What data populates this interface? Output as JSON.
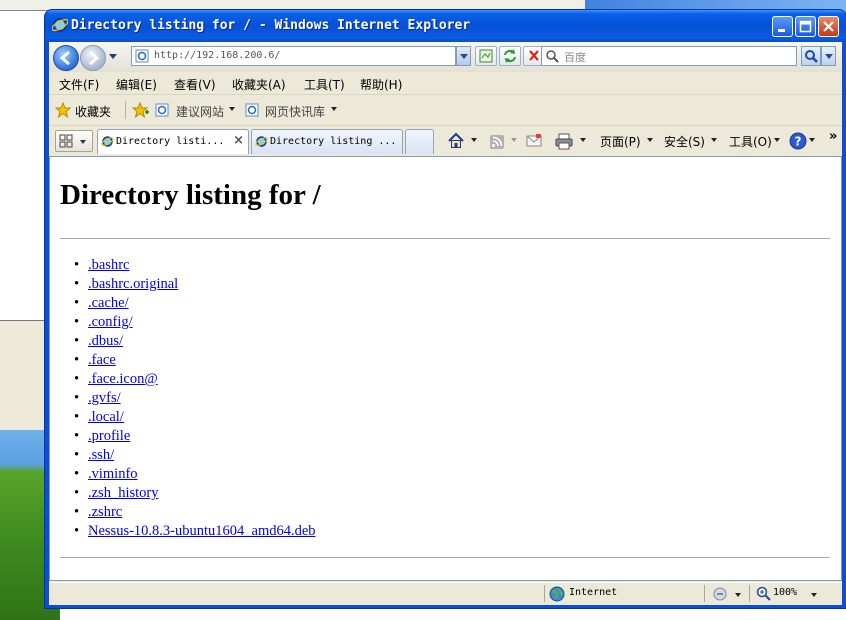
{
  "window": {
    "title": "Directory listing for / - Windows Internet Explorer"
  },
  "address": {
    "url": "http://192.168.200.6/"
  },
  "search": {
    "placeholder": "百度"
  },
  "menu": [
    "文件(F)",
    "编辑(E)",
    "查看(V)",
    "收藏夹(A)",
    "工具(T)",
    "帮助(H)"
  ],
  "favorites": {
    "label": "收藏夹",
    "links": [
      "建议网站",
      "网页快讯库"
    ]
  },
  "tabs": [
    {
      "label": "Directory listi..."
    },
    {
      "label": "Directory listing ..."
    }
  ],
  "command_bar": {
    "page": "页面(P)",
    "safety": "安全(S)",
    "tools": "工具(O)"
  },
  "page": {
    "heading": "Directory listing for /",
    "files": [
      ".bashrc",
      ".bashrc.original",
      ".cache/",
      ".config/",
      ".dbus/",
      ".face",
      ".face.icon@",
      ".gvfs/",
      ".local/",
      ".profile",
      ".ssh/",
      ".viminfo",
      ".zsh_history",
      ".zshrc",
      "Nessus-10.8.3-ubuntu1604_amd64.deb"
    ]
  },
  "status": {
    "zone": "Internet",
    "zoom": "100%"
  },
  "icons": [
    "ie-logo-icon",
    "minimize-icon",
    "maximize-icon",
    "close-icon",
    "back-icon",
    "forward-icon",
    "page-icon",
    "compat-icon",
    "refresh-icon",
    "stop-icon",
    "search-icon",
    "star-icon",
    "add-favorite-icon",
    "quick-tabs-icon",
    "tab-list-icon",
    "home-icon",
    "feeds-icon",
    "mail-icon",
    "print-icon",
    "help-icon",
    "globe-icon",
    "protected-mode-icon",
    "zoom-icon"
  ]
}
